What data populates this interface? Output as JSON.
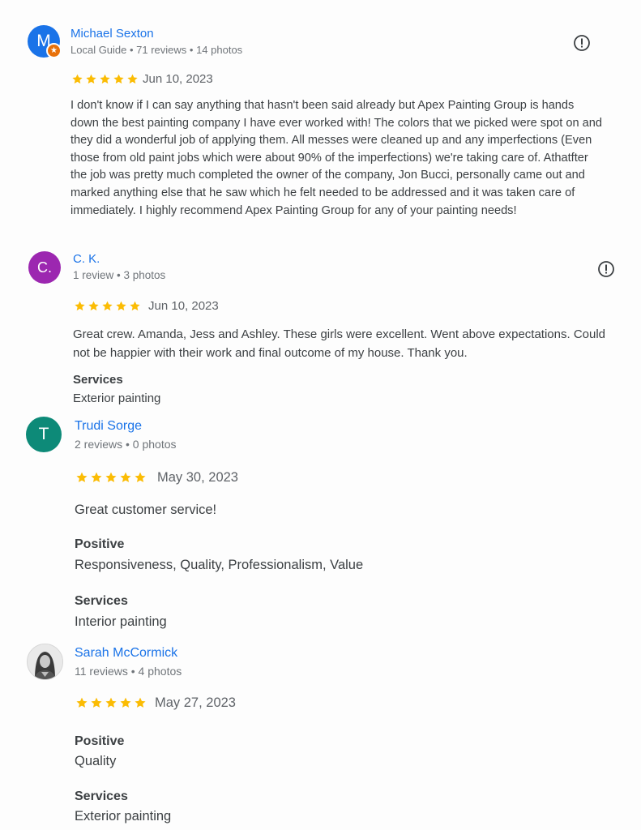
{
  "colors": {
    "link_blue": "#1a73e8",
    "star_yellow": "#fbbc04",
    "avatar_michael": "#1a73e8",
    "avatar_ck": "#9c27b0",
    "avatar_trudi": "#0d8a78",
    "guide_badge": "#e8710a"
  },
  "reviews": [
    {
      "avatar_letter": "M",
      "name": "Michael Sexton",
      "meta": "Local Guide • 71 reviews • 14 photos",
      "rating": 5,
      "date": "Jun 10, 2023",
      "text": "I don't know if I can say anything that hasn't been said already but Apex Painting Group is hands down the best painting company I have ever worked with! The colors that we picked were spot on and they did a wonderful job of applying them. All messes were cleaned up and any imperfections (Even those from old paint jobs which were about 90% of the imperfections) we're taking care of. Athatfter the job was pretty much completed the owner of the company, Jon Bucci, personally came out and marked anything else that he saw which he felt needed to be addressed and it was taken care of immediately. I highly recommend Apex Painting Group for any of your painting needs!"
    },
    {
      "avatar_letter": "C.",
      "name": "C. K.",
      "meta": "1 review • 3 photos",
      "rating": 5,
      "date": "Jun 10, 2023",
      "text": "Great crew. Amanda, Jess and Ashley. These girls were excellent. Went above expectations. Could not be happier with their work and final outcome of my house. Thank you.",
      "services_label": "Services",
      "services_value": "Exterior painting"
    },
    {
      "avatar_letter": "T",
      "name": "Trudi Sorge",
      "meta": "2 reviews • 0 photos",
      "rating": 5,
      "date": "May 30, 2023",
      "text": "Great customer service!",
      "positive_label": "Positive",
      "positive_value": "Responsiveness, Quality, Professionalism, Value",
      "services_label": "Services",
      "services_value": "Interior painting"
    },
    {
      "name": "Sarah McCormick",
      "meta": "11 reviews • 4 photos",
      "rating": 5,
      "date": "May 27, 2023",
      "positive_label": "Positive",
      "positive_value": "Quality",
      "services_label": "Services",
      "services_value": "Exterior painting"
    }
  ]
}
